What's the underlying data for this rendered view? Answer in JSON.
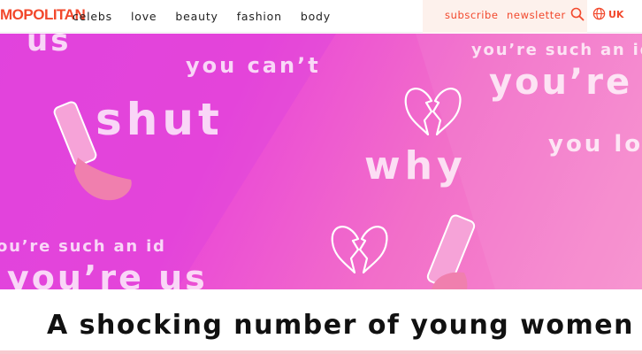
{
  "header": {
    "logo": "MOPOLITAN",
    "nav": [
      "celebs",
      "love",
      "beauty",
      "fashion",
      "body"
    ],
    "subscribe": "subscribe",
    "newsletter": "newsletter",
    "region": "UK",
    "icons": {
      "search": "search-icon",
      "globe": "globe-icon"
    }
  },
  "hero": {
    "words": [
      "us",
      "you can’t",
      "shut",
      "why",
      "you’re such an id",
      "you’re",
      "you lo",
      "ou’re such an id",
      "you’re us"
    ],
    "icons": [
      "phone-in-hand-icon",
      "broken-heart-icon"
    ]
  },
  "article": {
    "headline": "A shocking number of young women"
  },
  "colors": {
    "brand": "#f2482c",
    "hero_start": "#e545dc",
    "hero_end": "#f790ce",
    "headline": "#111111"
  }
}
